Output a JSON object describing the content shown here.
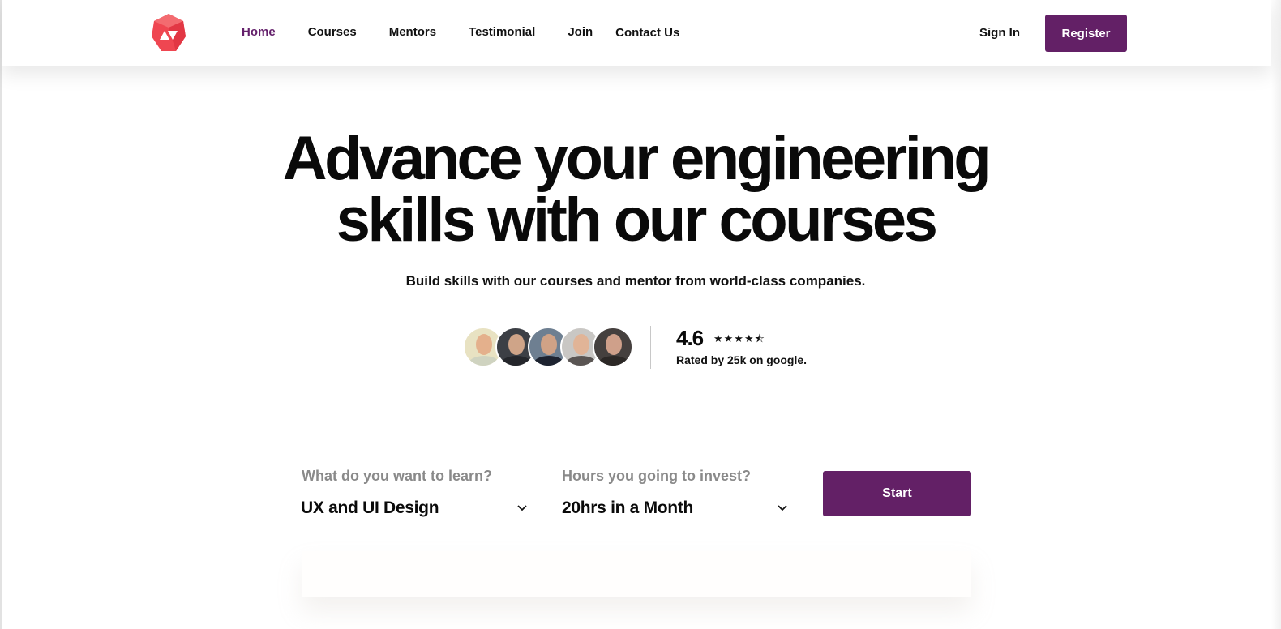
{
  "nav": {
    "logo": "logo-icon",
    "items": [
      {
        "label": "Home",
        "active": true
      },
      {
        "label": "Courses",
        "active": false
      },
      {
        "label": "Mentors",
        "active": false
      },
      {
        "label": "Testimonial",
        "active": false
      },
      {
        "label": "Join",
        "active": false
      },
      {
        "label": "Contact Us",
        "active": false
      }
    ],
    "sign_in": "Sign In",
    "register": "Register"
  },
  "hero": {
    "title_line1": "Advance your engineering",
    "title_line2": "skills with our courses",
    "subtitle": "Build skills with our courses and mentor from world-class companies."
  },
  "rating": {
    "value": "4.6",
    "stars": "★★★★⯪",
    "star_fraction": 0.92,
    "caption": "Rated by 25k on google.",
    "avatars": [
      "avatar-1",
      "avatar-2",
      "avatar-3",
      "avatar-4",
      "avatar-5"
    ]
  },
  "form": {
    "learn_label": "What do you want to learn?",
    "learn_value": "UX and UI Design",
    "hours_label": "Hours you going to invest?",
    "hours_value": "20hrs in a Month",
    "start": "Start"
  },
  "colors": {
    "brand": "#632066",
    "active_nav": "#64206b",
    "logo": "#ef4651"
  }
}
